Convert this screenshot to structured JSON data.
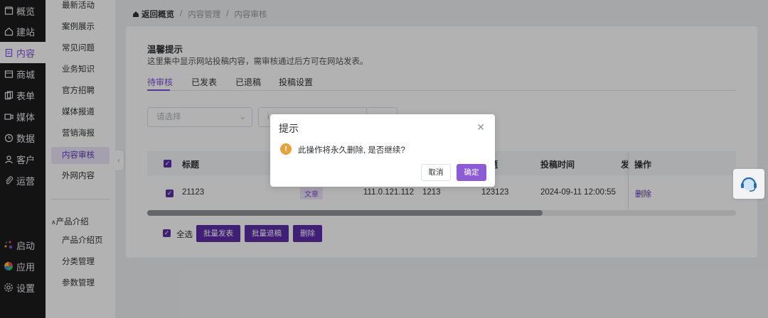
{
  "nav": {
    "items": [
      {
        "label": "概览",
        "icon": "shop-icon"
      },
      {
        "label": "建站",
        "icon": "home-icon"
      },
      {
        "label": "内容",
        "icon": "document-icon",
        "active": true
      },
      {
        "label": "商城",
        "icon": "store-icon"
      },
      {
        "label": "表单",
        "icon": "form-icon"
      },
      {
        "label": "媒体",
        "icon": "video-icon"
      },
      {
        "label": "数据",
        "icon": "clock-icon"
      },
      {
        "label": "客户",
        "icon": "user-icon"
      },
      {
        "label": "运营",
        "icon": "paperclip-icon"
      }
    ],
    "bottom": [
      {
        "label": "启动",
        "icon": "launch-icon"
      },
      {
        "label": "应用",
        "icon": "apps-icon"
      },
      {
        "label": "设置",
        "icon": "gear-icon"
      }
    ]
  },
  "subnav": {
    "items": [
      "最新活动",
      "案例展示",
      "常见问题",
      "业务知识",
      "官方招聘",
      "媒体报道",
      "营销海报",
      "内容审核",
      "外网内容"
    ],
    "active_index": 7,
    "group_title": "产品介绍",
    "group_items": [
      "产品介绍页",
      "分类管理",
      "参数管理"
    ]
  },
  "breadcrumb": {
    "home": "返回概览",
    "sep": "/",
    "items": [
      "内容管理",
      "内容审核"
    ]
  },
  "notice": {
    "title": "温馨提示",
    "text": "这里集中显示网站投稿内容，需审核通过后方可在网站发表。"
  },
  "tabs": [
    "待审核",
    "已发表",
    "已退稿",
    "投稿设置"
  ],
  "filter": {
    "select_placeholder": "请选择",
    "search_prefix": "i"
  },
  "table": {
    "headers": [
      "标题",
      "投稿时间",
      "发",
      "操作"
    ],
    "header_partial": "题",
    "row": {
      "title": "21123",
      "tag": "文章",
      "ip": "111.0.121.112",
      "col4": "1213",
      "col5": "123123",
      "time": "2024-09-11 12:00:55",
      "action": "删除"
    }
  },
  "footer": {
    "select_all": "全选",
    "buttons": [
      "批量发表",
      "批量退稿",
      "删除"
    ]
  },
  "dialog": {
    "title": "提示",
    "message": "此操作将永久删除, 是否继续?",
    "cancel": "取消",
    "confirm": "确定"
  },
  "colors": {
    "accent": "#7d4fd6",
    "accent_dark": "#5b2fa8",
    "warning": "#e6a23c",
    "nav_bg": "#1c1c1e"
  }
}
